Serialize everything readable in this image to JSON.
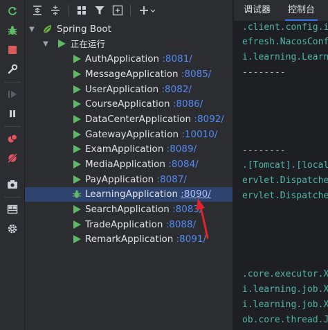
{
  "tree": {
    "root": {
      "label": "Spring Boot"
    },
    "group": {
      "label": "正在运行"
    },
    "apps": [
      {
        "name": "AuthApplication",
        "port": ":8081/"
      },
      {
        "name": "MessageApplication",
        "port": ":8085/"
      },
      {
        "name": "UserApplication",
        "port": ":8082/"
      },
      {
        "name": "CourseApplication",
        "port": ":8086/"
      },
      {
        "name": "DataCenterApplication",
        "port": ":8092/"
      },
      {
        "name": "GatewayApplication",
        "port": ":10010/"
      },
      {
        "name": "ExamApplication",
        "port": ":8089/"
      },
      {
        "name": "MediaApplication",
        "port": ":8084/"
      },
      {
        "name": "PayApplication",
        "port": ":8087/"
      },
      {
        "name": "LearningApplication",
        "port": ":8090/"
      },
      {
        "name": "SearchApplication",
        "port": ":8083/"
      },
      {
        "name": "TradeApplication",
        "port": ":8088/"
      },
      {
        "name": "RemarkApplication",
        "port": ":8091/"
      }
    ],
    "selected_app": "LearningApplication"
  },
  "console": {
    "tabs": [
      {
        "label": "调试器"
      },
      {
        "label": "控制台"
      }
    ],
    "active_tab": "控制台",
    "lines": [
      ".client.config.i",
      "efresh.NacosConf",
      "i.learning.Learn",
      "--------",
      "--------",
      ".[Tomcat].[local",
      "ervlet.Dispatche",
      "ervlet.Dispatche",
      ".core.executor.X",
      "i.learning.job.X",
      "i.learning.job.X",
      "ob.core.thread.J"
    ]
  },
  "colors": {
    "background": "#2b2d30",
    "console_background": "#1e1f22",
    "selection": "#2e436e",
    "port_link": "#548af7",
    "run_green": "#5fb865",
    "console_text": "#4fb5a8",
    "annotation_arrow": "#e0242c"
  },
  "icons": {
    "left_toolbar": [
      "rerun-icon",
      "debug-icon",
      "stop-icon",
      "wrench-icon",
      "resume-icon",
      "pause-icon",
      "breakpoints-icon",
      "mute-breakpoints-icon",
      "camera-icon",
      "layout-icon",
      "settings-icon"
    ],
    "top_toolbar": [
      "expand-all-icon",
      "collapse-all-icon",
      "group-services-icon",
      "filter-icon",
      "new-group-icon",
      "add-icon"
    ]
  }
}
